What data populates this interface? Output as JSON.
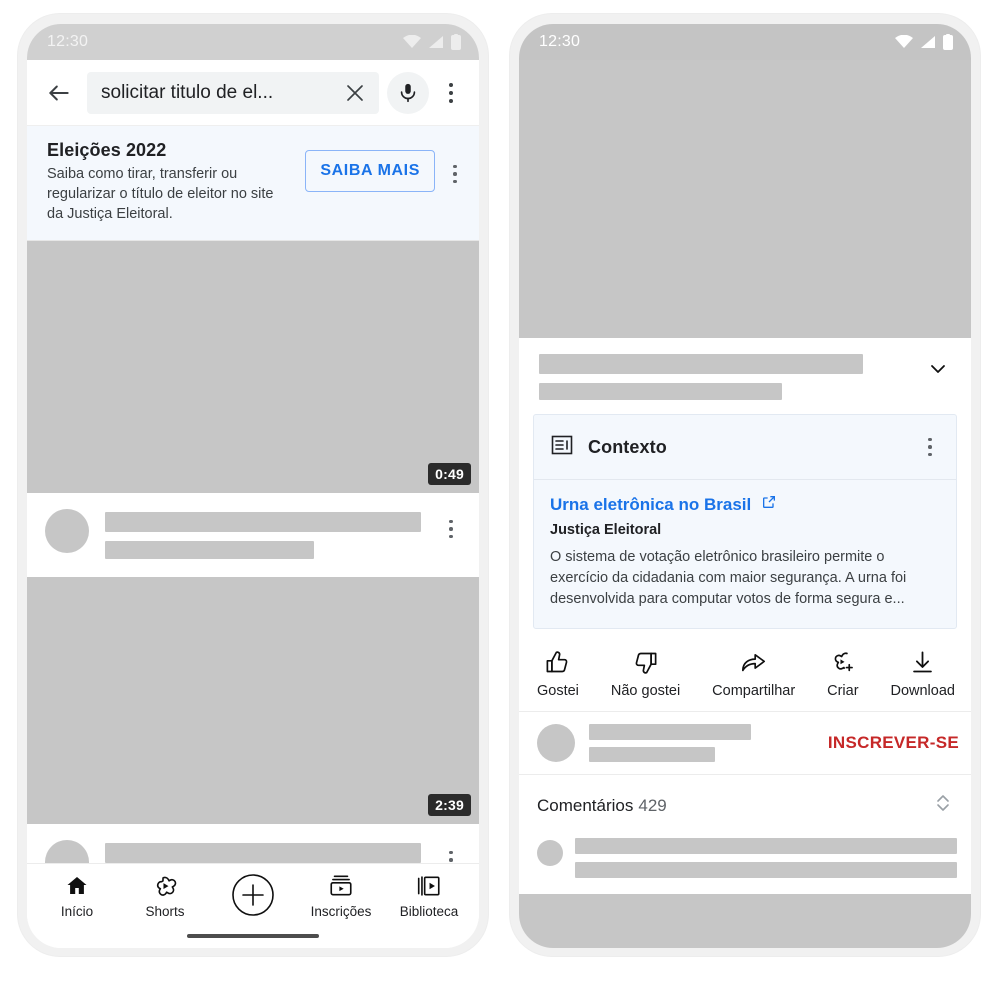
{
  "phones": {
    "left": {
      "status": {
        "time": "12:30",
        "icons": [
          "wifi-icon",
          "signal-icon",
          "battery-icon"
        ]
      },
      "appbar": {
        "back_icon": "back-arrow-icon",
        "search_value": "solicitar titulo de el...",
        "search_placeholder": "Pesquisar",
        "clear_icon": "close-icon",
        "mic_icon": "microphone-icon",
        "overflow_icon": "more-vert-icon"
      },
      "info_card": {
        "title": "Eleições 2022",
        "body": "Saiba como tirar, transferir ou regularizar o título de eleitor no site da Justiça Eleitoral.",
        "cta_label": "SAIBA MAIS",
        "overflow_icon": "more-vert-icon"
      },
      "feed": [
        {
          "duration": "0:49"
        },
        {
          "duration": "2:39"
        }
      ],
      "bottom_nav": [
        {
          "label": "Início",
          "icon": "home-icon"
        },
        {
          "label": "Shorts",
          "icon": "shorts-icon"
        },
        {
          "label": "",
          "icon": "plus-circle-icon"
        },
        {
          "label": "Inscrições",
          "icon": "subscriptions-icon"
        },
        {
          "label": "Biblioteca",
          "icon": "library-icon"
        }
      ]
    },
    "right": {
      "status": {
        "time": "12:30",
        "icons": [
          "wifi-icon",
          "signal-icon",
          "battery-icon"
        ]
      },
      "player": {
        "icon": "video-player-area"
      },
      "title_row": {
        "expand_icon": "chevron-down-icon"
      },
      "context_card": {
        "icon": "article-icon",
        "header": "Contexto",
        "overflow_icon": "more-vert-icon",
        "link_title": "Urna eletrônica no Brasil",
        "external_icon": "open-in-new-icon",
        "source": "Justiça Eleitoral",
        "description": "O sistema de votação eletrônico brasileiro permite o exercício da cidadania com maior segurança. A urna foi desenvolvida para computar votos de forma segura e..."
      },
      "actions": [
        {
          "label": "Gostei",
          "icon": "thumb-up-icon"
        },
        {
          "label": "Não gostei",
          "icon": "thumb-down-icon"
        },
        {
          "label": "Compartilhar",
          "icon": "share-icon"
        },
        {
          "label": "Criar",
          "icon": "create-clip-icon"
        },
        {
          "label": "Download",
          "icon": "download-icon"
        }
      ],
      "channel_row": {
        "subscribe_label": "INSCREVER-SE"
      },
      "comments": {
        "label": "Comentários",
        "count": "429",
        "sort_icon": "sort-updown-icon"
      }
    }
  },
  "colors": {
    "link_blue": "#1a73e8",
    "cta_border": "#8ab4f8",
    "info_bg": "#f4f8fd",
    "skeleton": "#c6c6c6",
    "subscribe_red": "#c62828",
    "status_bar": "#c4c4c4"
  }
}
